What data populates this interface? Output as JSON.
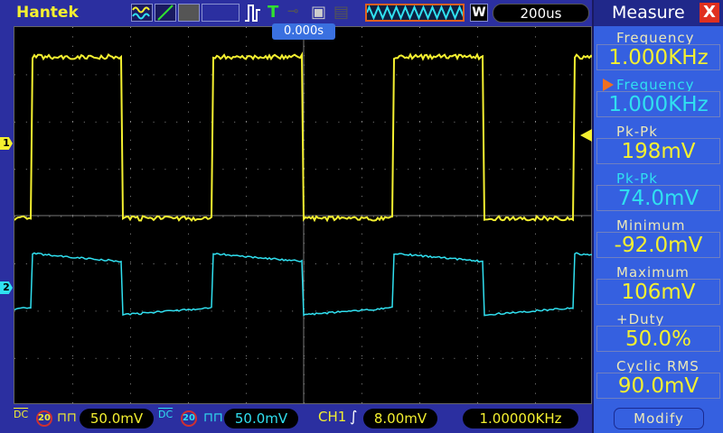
{
  "header": {
    "brand": "Hantek",
    "timebase": "200us",
    "mode": "W",
    "trigger_position": "0.000s"
  },
  "channels": [
    {
      "name": "CH1",
      "marker": "1",
      "coupling": "DC",
      "bw_limit": "20",
      "scale": "50.0mV",
      "color": "#f4f030"
    },
    {
      "name": "CH2",
      "marker": "2",
      "coupling": "DC",
      "bw_limit": "20",
      "scale": "50.0mV",
      "color": "#30e0f0"
    }
  ],
  "trigger": {
    "source": "CH1",
    "level": "8.00mV",
    "frequency": "1.00000KHz"
  },
  "measure": {
    "title": "Measure",
    "close": "X",
    "items": [
      {
        "label": "Frequency",
        "value": "1.000KHz",
        "ch": "y"
      },
      {
        "label": "Frequency",
        "value": "1.000KHz",
        "ch": "c"
      },
      {
        "label": "Pk-Pk",
        "value": "198mV",
        "ch": "y"
      },
      {
        "label": "Pk-Pk",
        "value": "74.0mV",
        "ch": "c"
      },
      {
        "label": "Minimum",
        "value": "-92.0mV",
        "ch": "y"
      },
      {
        "label": "Maximum",
        "value": "106mV",
        "ch": "y"
      },
      {
        "label": "+Duty",
        "value": "50.0%",
        "ch": "y"
      },
      {
        "label": "Cyclic RMS",
        "value": "90.0mV",
        "ch": "y"
      }
    ],
    "modify": "Modify"
  }
}
